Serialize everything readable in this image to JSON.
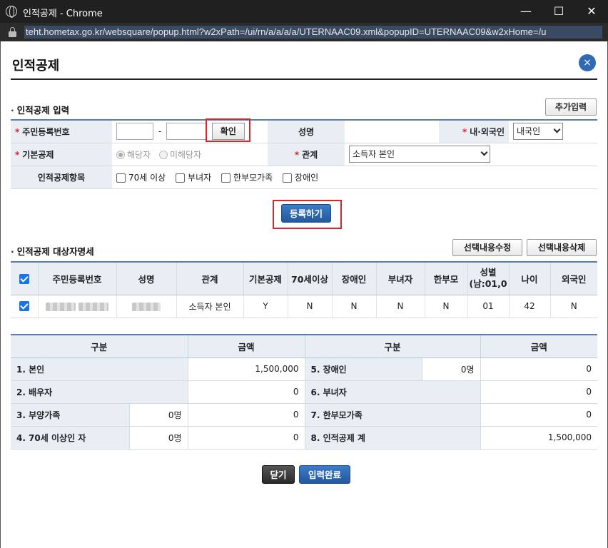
{
  "window": {
    "title": "인적공제 - Chrome",
    "url": "teht.hometax.go.kr/websquare/popup.html?w2xPath=/ui/rn/a/a/a/a/UTERNAAC09.xml&popupID=UTERNAAC09&w2xHome=/u"
  },
  "page": {
    "title": "인적공제",
    "close_symbol": "×"
  },
  "input_section": {
    "title": "인적공제 입력",
    "add_button": "추가입력",
    "rrn_label": "주민등록번호",
    "rrn_separator": "-",
    "confirm_button": "확인",
    "name_label": "성명",
    "nationality_label": "내·외국인",
    "nationality_value": "내국인",
    "basic_label": "기본공제",
    "basic_options": [
      "해당자",
      "미해당자"
    ],
    "relation_label": "관계",
    "relation_value": "소득자 본인",
    "items_label": "인적공제항목",
    "items": [
      "70세 이상",
      "부녀자",
      "한부모가족",
      "장애인"
    ],
    "register_button": "등록하기"
  },
  "list_section": {
    "title": "인적공제 대상자명세",
    "edit_button": "선택내용수정",
    "delete_button": "선택내용삭제",
    "headers": [
      "주민등록번호",
      "성명",
      "관계",
      "기본공제",
      "70세이상",
      "장애인",
      "부녀자",
      "한부모",
      "성별\n(남:01,0",
      "나이",
      "외국인"
    ],
    "gender_header_line1": "성별",
    "gender_header_line2": "(남:01,0",
    "row": {
      "relation": "소득자 본인",
      "basic": "Y",
      "over70": "N",
      "disabled": "N",
      "woman": "N",
      "single_parent": "N",
      "gender": "01",
      "age": "42",
      "foreigner": "N"
    }
  },
  "summary": {
    "headers": [
      "구분",
      "금액",
      "구분",
      "금액"
    ],
    "rows": [
      {
        "left_label": "1. 본인",
        "left_count": "",
        "left_amount": "1,500,000",
        "right_label": "5. 장애인",
        "right_count": "0명",
        "right_amount": "0"
      },
      {
        "left_label": "2. 배우자",
        "left_count": "",
        "left_amount": "0",
        "right_label": "6. 부녀자",
        "right_count": "",
        "right_amount": "0"
      },
      {
        "left_label": "3. 부양가족",
        "left_count": "0명",
        "left_amount": "0",
        "right_label": "7. 한부모가족",
        "right_count": "",
        "right_amount": "0"
      },
      {
        "left_label": "4. 70세 이상인 자",
        "left_count": "0명",
        "left_amount": "0",
        "right_label": "8. 인적공제 계",
        "right_count": "",
        "right_amount": "1,500,000"
      }
    ]
  },
  "footer": {
    "close_button": "닫기",
    "complete_button": "입력완료"
  },
  "colors": {
    "accent_blue": "#2f6ab4",
    "header_bg": "#e9eef5",
    "highlight_red": "#d9262b"
  }
}
